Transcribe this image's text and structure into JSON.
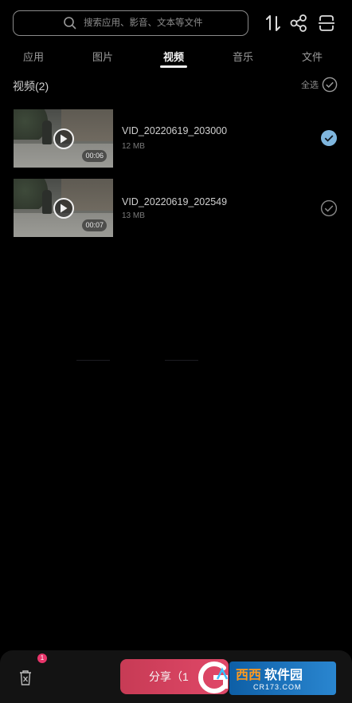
{
  "search": {
    "placeholder": "搜索应用、影音、文本等文件"
  },
  "tabs": [
    {
      "label": "应用"
    },
    {
      "label": "图片"
    },
    {
      "label": "视频"
    },
    {
      "label": "音乐"
    },
    {
      "label": "文件"
    }
  ],
  "active_tab": "视频",
  "section": {
    "title": "视频(2)",
    "select_all": "全选"
  },
  "files": [
    {
      "name": "VID_20220619_203000",
      "size": "12 MB",
      "duration": "00:06",
      "selected": true
    },
    {
      "name": "VID_20220619_202549",
      "size": "13 MB",
      "duration": "00:07",
      "selected": false
    }
  ],
  "bottom": {
    "badge_count": "1",
    "share_label": "分享（1"
  },
  "watermark": {
    "title_a": "西西",
    "title_b": "软件园",
    "sub": "CR173.COM"
  },
  "colors": {
    "accent_check": "#7fb6de",
    "share_button": "#d9445f",
    "badge": "#e8356a"
  },
  "icons": [
    "search-icon",
    "sort-icon",
    "share-icon",
    "scan-icon",
    "check-icon",
    "play-icon",
    "trash-icon"
  ]
}
